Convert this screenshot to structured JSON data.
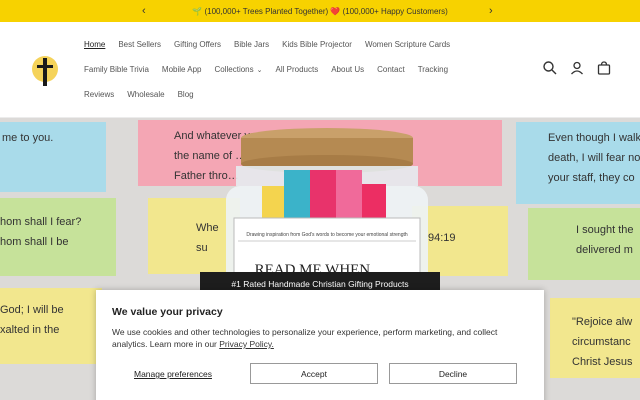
{
  "announcement": {
    "text": "🌱 (100,000+ Trees Planted Together) ❤️ (100,000+ Happy Customers)",
    "prev": "‹",
    "next": "›"
  },
  "nav": {
    "row1": [
      "Home",
      "Best Sellers",
      "Gifting Offers",
      "Bible Jars",
      "Kids Bible Projector",
      "Women Scripture Cards"
    ],
    "row2": [
      "Family Bible Trivia",
      "Mobile App",
      "Collections",
      "All Products",
      "About Us",
      "Contact",
      "Tracking"
    ],
    "row3": [
      "Reviews",
      "Wholesale",
      "Blog"
    ],
    "collections_chevron": "⌄"
  },
  "hero": {
    "notes": [
      "me to you.",
      "And whatever yo… do everything in\nthe name of … to God the\nFather thro…",
      "Even though I walk\ndeath, I will fear no\nyour staff, they co",
      "hom shall I fear?\nhom shall I be",
      "Whe\nsu",
      "94:19",
      "I sought the\ndelivered m",
      "God; I will be\nxalted in the",
      "\"Rejoice alw\ncircumstanc\nChrist Jesus"
    ],
    "jar_label_small": "Drawing inspiration from God's words to become your emotional strength",
    "jar_label_big": "READ ME WHEN...",
    "badge": "#1 Rated Handmade Christian Gifting Products"
  },
  "cookie": {
    "title": "We value your privacy",
    "text": "We use cookies and other technologies to personalize your experience, perform marketing, and collect analytics. Learn more in our",
    "link": "Privacy Policy.",
    "manage": "Manage preferences",
    "accept": "Accept",
    "decline": "Decline"
  },
  "colors": {
    "announcement_bg": "#f7d200",
    "note_pink": "#f4a6b4",
    "note_blue": "#a9dbea",
    "note_green": "#c6e29a",
    "note_yellow": "#f2e78e"
  },
  "icons": [
    "logo-cross-icon",
    "search-icon",
    "account-icon",
    "cart-icon",
    "chevron-left-icon",
    "chevron-right-icon"
  ]
}
